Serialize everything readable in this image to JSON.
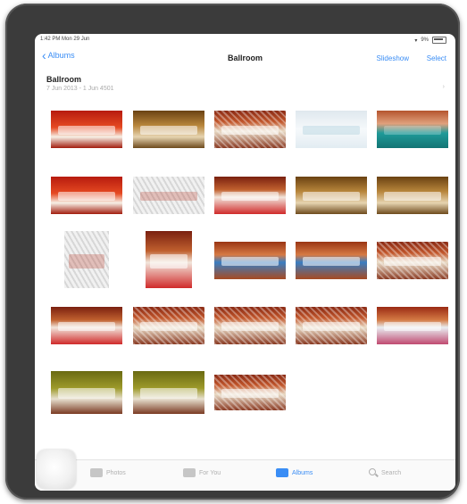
{
  "status": {
    "time": "1:42 PM  Mon 29 Jun",
    "battery": "9%"
  },
  "nav": {
    "back_label": "Albums",
    "title": "Ballroom",
    "slideshow_label": "Slideshow",
    "select_label": "Select"
  },
  "album": {
    "name": "Ballroom",
    "dates": "7 Jun 2013 - 1 Jun 4501"
  },
  "tabs": [
    {
      "label": "Photos",
      "icon": "photos-icon",
      "active": false
    },
    {
      "label": "For You",
      "icon": "for-you-icon",
      "active": false
    },
    {
      "label": "Albums",
      "icon": "albums-icon",
      "active": true
    },
    {
      "label": "Search",
      "icon": "search-icon",
      "active": false
    }
  ],
  "colors": {
    "accent": "#3a8df5"
  }
}
